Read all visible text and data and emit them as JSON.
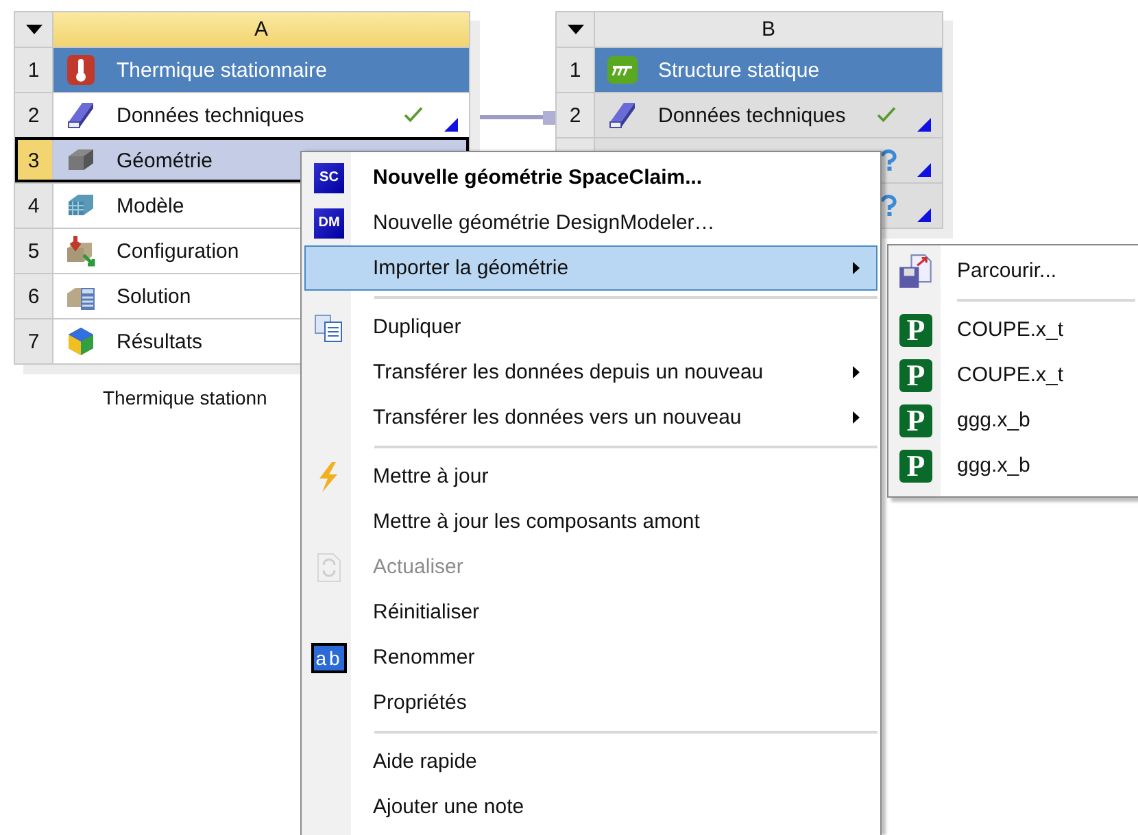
{
  "systems": [
    {
      "column": "A",
      "selected": true,
      "caption": "Thermique stationn",
      "rows": [
        {
          "number": "1",
          "kind": "analysis-thermal",
          "label": "Thermique stationnaire",
          "selected": false
        },
        {
          "number": "2",
          "kind": "data",
          "label": "Données techniques",
          "complete": true,
          "selected": false
        },
        {
          "number": "3",
          "kind": "geometry",
          "label": "Géométrie",
          "selected": true
        },
        {
          "number": "4",
          "kind": "model",
          "label": "Modèle",
          "selected": false
        },
        {
          "number": "5",
          "kind": "setup",
          "label": "Configuration",
          "selected": false
        },
        {
          "number": "6",
          "kind": "solution",
          "label": "Solution",
          "selected": false
        },
        {
          "number": "7",
          "kind": "results",
          "label": "Résultats",
          "selected": false
        }
      ]
    },
    {
      "column": "B",
      "selected": false,
      "rows": [
        {
          "number": "1",
          "kind": "analysis-structural",
          "label": "Structure statique",
          "selected": false
        },
        {
          "number": "2",
          "kind": "data",
          "label": "Données techniques",
          "complete": true,
          "selected": false
        },
        {
          "complete": false,
          "selected": false
        },
        {
          "complete": false,
          "selected": false
        }
      ]
    }
  ],
  "menu": {
    "items": [
      {
        "kind": "item",
        "label": "Nouvelle géométrie SpaceClaim...",
        "badge": {
          "text": "SC",
          "kind": "product"
        },
        "default": true,
        "disabled": false,
        "submenu": false,
        "selected": false
      },
      {
        "kind": "item",
        "label": "Nouvelle géométrie DesignModeler…",
        "badge": {
          "text": "DM",
          "kind": "product"
        },
        "default": false,
        "disabled": false,
        "submenu": false,
        "selected": false
      },
      {
        "kind": "item",
        "label": "Importer la géométrie",
        "default": false,
        "disabled": false,
        "submenu": true,
        "selected": true
      },
      {
        "kind": "separator"
      },
      {
        "kind": "item",
        "label": "Dupliquer",
        "disabled": false,
        "submenu": false,
        "selected": false
      },
      {
        "kind": "item",
        "label": "Transférer les données depuis un nouveau",
        "default": false,
        "disabled": false,
        "submenu": true,
        "selected": false
      },
      {
        "kind": "item",
        "label": "Transférer les données vers un nouveau",
        "default": false,
        "disabled": false,
        "submenu": true,
        "selected": false
      },
      {
        "kind": "separator"
      },
      {
        "kind": "item",
        "label": "Mettre à jour",
        "default": false,
        "disabled": false,
        "submenu": false,
        "selected": false
      },
      {
        "kind": "item",
        "label": "Mettre à jour les composants amont",
        "default": false,
        "disabled": false,
        "submenu": false,
        "selected": false
      },
      {
        "kind": "item",
        "label": "Actualiser",
        "default": false,
        "disabled": true,
        "submenu": false,
        "selected": false
      },
      {
        "kind": "item",
        "label": "Réinitialiser",
        "default": false,
        "disabled": false,
        "submenu": false,
        "selected": false
      },
      {
        "kind": "item",
        "label": "Renommer",
        "badge": {
          "text": "ab",
          "kind": "rename"
        },
        "default": false,
        "disabled": false,
        "submenu": false,
        "selected": false
      },
      {
        "kind": "item",
        "label": "Propriétés",
        "default": false,
        "disabled": false,
        "submenu": false,
        "selected": false
      },
      {
        "kind": "separator"
      },
      {
        "kind": "item",
        "label": "Aide rapide",
        "default": false,
        "disabled": false,
        "submenu": false,
        "selected": false
      },
      {
        "kind": "item",
        "label": "Ajouter une note",
        "default": false,
        "disabled": false,
        "submenu": false,
        "selected": false
      }
    ]
  },
  "submenu": {
    "items": [
      {
        "kind": "browse",
        "label": "Parcourir..."
      },
      {
        "kind": "separator"
      },
      {
        "kind": "file",
        "label": "COUPE.x_t",
        "badge": "P"
      },
      {
        "kind": "file",
        "label": "COUPE.x_t",
        "badge": "P"
      },
      {
        "kind": "file",
        "label": "ggg.x_b",
        "badge": "P"
      },
      {
        "kind": "file",
        "label": "ggg.x_b",
        "badge": "P"
      }
    ]
  }
}
